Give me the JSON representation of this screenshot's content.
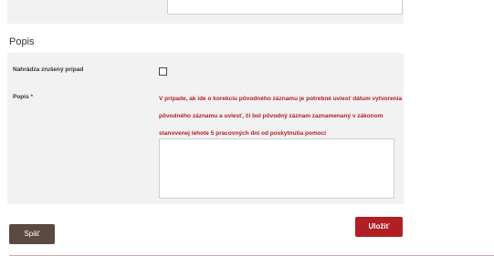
{
  "section": {
    "title": "Popis"
  },
  "fields": {
    "replacement_label": "Nahrádza zrušený prípad",
    "replacement_checked": false,
    "description_label": "Popis",
    "required_marker": "*",
    "help_text_lines": [
      "V prípade, ak ide o korekciu pôvodného záznamu je potrebné uviesť dátum vytvorenia",
      "pôvodného záznamu a uviesť, či bol pôvodný záznam zaznamenaný v zákonom",
      "stanovenej lehote 5 pracovných dní od poskytnutia pomoci"
    ],
    "description_value": ""
  },
  "buttons": {
    "back_label": "Späť",
    "save_label": "Uložiť"
  },
  "colors": {
    "accent": "#b11f24",
    "back_button": "#5b4a41",
    "panel_bg": "#f2f2f2"
  },
  "icons": {
    "checkbox": "checkbox-icon"
  }
}
